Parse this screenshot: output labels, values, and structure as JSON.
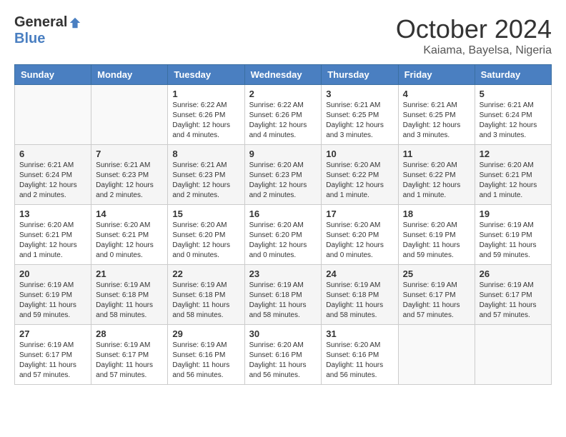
{
  "header": {
    "logo_general": "General",
    "logo_blue": "Blue",
    "month_title": "October 2024",
    "location": "Kaiama, Bayelsa, Nigeria"
  },
  "calendar": {
    "days_of_week": [
      "Sunday",
      "Monday",
      "Tuesday",
      "Wednesday",
      "Thursday",
      "Friday",
      "Saturday"
    ],
    "weeks": [
      [
        {
          "day": "",
          "info": ""
        },
        {
          "day": "",
          "info": ""
        },
        {
          "day": "1",
          "info": "Sunrise: 6:22 AM\nSunset: 6:26 PM\nDaylight: 12 hours and 4 minutes."
        },
        {
          "day": "2",
          "info": "Sunrise: 6:22 AM\nSunset: 6:26 PM\nDaylight: 12 hours and 4 minutes."
        },
        {
          "day": "3",
          "info": "Sunrise: 6:21 AM\nSunset: 6:25 PM\nDaylight: 12 hours and 3 minutes."
        },
        {
          "day": "4",
          "info": "Sunrise: 6:21 AM\nSunset: 6:25 PM\nDaylight: 12 hours and 3 minutes."
        },
        {
          "day": "5",
          "info": "Sunrise: 6:21 AM\nSunset: 6:24 PM\nDaylight: 12 hours and 3 minutes."
        }
      ],
      [
        {
          "day": "6",
          "info": "Sunrise: 6:21 AM\nSunset: 6:24 PM\nDaylight: 12 hours and 2 minutes."
        },
        {
          "day": "7",
          "info": "Sunrise: 6:21 AM\nSunset: 6:23 PM\nDaylight: 12 hours and 2 minutes."
        },
        {
          "day": "8",
          "info": "Sunrise: 6:21 AM\nSunset: 6:23 PM\nDaylight: 12 hours and 2 minutes."
        },
        {
          "day": "9",
          "info": "Sunrise: 6:20 AM\nSunset: 6:23 PM\nDaylight: 12 hours and 2 minutes."
        },
        {
          "day": "10",
          "info": "Sunrise: 6:20 AM\nSunset: 6:22 PM\nDaylight: 12 hours and 1 minute."
        },
        {
          "day": "11",
          "info": "Sunrise: 6:20 AM\nSunset: 6:22 PM\nDaylight: 12 hours and 1 minute."
        },
        {
          "day": "12",
          "info": "Sunrise: 6:20 AM\nSunset: 6:21 PM\nDaylight: 12 hours and 1 minute."
        }
      ],
      [
        {
          "day": "13",
          "info": "Sunrise: 6:20 AM\nSunset: 6:21 PM\nDaylight: 12 hours and 1 minute."
        },
        {
          "day": "14",
          "info": "Sunrise: 6:20 AM\nSunset: 6:21 PM\nDaylight: 12 hours and 0 minutes."
        },
        {
          "day": "15",
          "info": "Sunrise: 6:20 AM\nSunset: 6:20 PM\nDaylight: 12 hours and 0 minutes."
        },
        {
          "day": "16",
          "info": "Sunrise: 6:20 AM\nSunset: 6:20 PM\nDaylight: 12 hours and 0 minutes."
        },
        {
          "day": "17",
          "info": "Sunrise: 6:20 AM\nSunset: 6:20 PM\nDaylight: 12 hours and 0 minutes."
        },
        {
          "day": "18",
          "info": "Sunrise: 6:20 AM\nSunset: 6:19 PM\nDaylight: 11 hours and 59 minutes."
        },
        {
          "day": "19",
          "info": "Sunrise: 6:19 AM\nSunset: 6:19 PM\nDaylight: 11 hours and 59 minutes."
        }
      ],
      [
        {
          "day": "20",
          "info": "Sunrise: 6:19 AM\nSunset: 6:19 PM\nDaylight: 11 hours and 59 minutes."
        },
        {
          "day": "21",
          "info": "Sunrise: 6:19 AM\nSunset: 6:18 PM\nDaylight: 11 hours and 58 minutes."
        },
        {
          "day": "22",
          "info": "Sunrise: 6:19 AM\nSunset: 6:18 PM\nDaylight: 11 hours and 58 minutes."
        },
        {
          "day": "23",
          "info": "Sunrise: 6:19 AM\nSunset: 6:18 PM\nDaylight: 11 hours and 58 minutes."
        },
        {
          "day": "24",
          "info": "Sunrise: 6:19 AM\nSunset: 6:18 PM\nDaylight: 11 hours and 58 minutes."
        },
        {
          "day": "25",
          "info": "Sunrise: 6:19 AM\nSunset: 6:17 PM\nDaylight: 11 hours and 57 minutes."
        },
        {
          "day": "26",
          "info": "Sunrise: 6:19 AM\nSunset: 6:17 PM\nDaylight: 11 hours and 57 minutes."
        }
      ],
      [
        {
          "day": "27",
          "info": "Sunrise: 6:19 AM\nSunset: 6:17 PM\nDaylight: 11 hours and 57 minutes."
        },
        {
          "day": "28",
          "info": "Sunrise: 6:19 AM\nSunset: 6:17 PM\nDaylight: 11 hours and 57 minutes."
        },
        {
          "day": "29",
          "info": "Sunrise: 6:19 AM\nSunset: 6:16 PM\nDaylight: 11 hours and 56 minutes."
        },
        {
          "day": "30",
          "info": "Sunrise: 6:20 AM\nSunset: 6:16 PM\nDaylight: 11 hours and 56 minutes."
        },
        {
          "day": "31",
          "info": "Sunrise: 6:20 AM\nSunset: 6:16 PM\nDaylight: 11 hours and 56 minutes."
        },
        {
          "day": "",
          "info": ""
        },
        {
          "day": "",
          "info": ""
        }
      ]
    ]
  }
}
